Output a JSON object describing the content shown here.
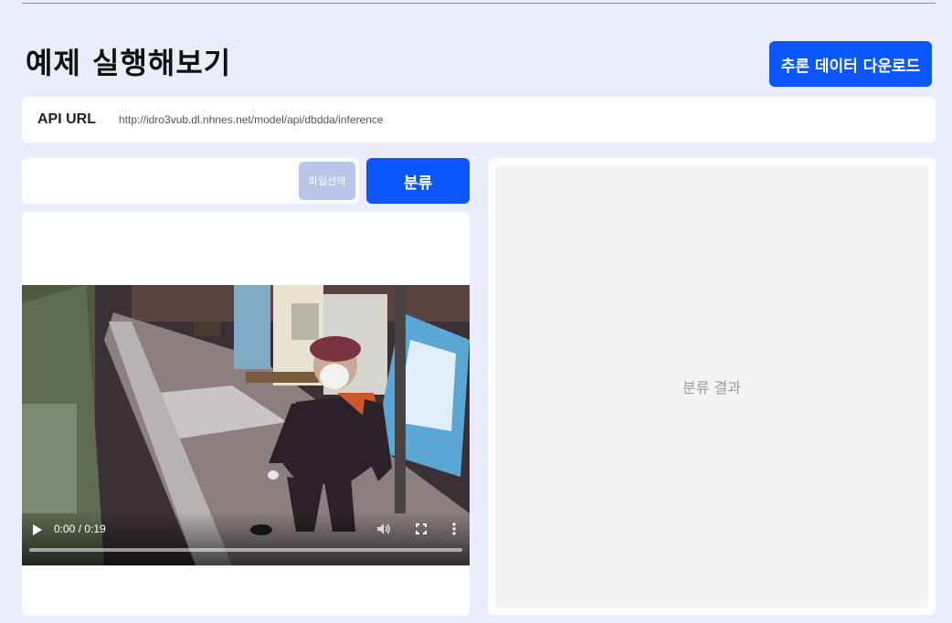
{
  "page": {
    "title": "예제 실행해보기",
    "download_button_label": "추론 데이터 다운로드"
  },
  "api": {
    "label": "API URL",
    "url": "http://idro3vub.dl.nhnes.net/model/api/dbdda/inference"
  },
  "upload": {
    "file_name": "",
    "file_select_label": "파일선택",
    "classify_label": "분류"
  },
  "video": {
    "current_time": "0:00",
    "duration": "0:19",
    "time_display": "0:00 / 0:19",
    "progress_fraction": 0.0,
    "play_icon": "play-icon",
    "volume_icon": "volume-icon",
    "fullscreen_icon": "fullscreen-icon",
    "more_icon": "more-vertical-icon"
  },
  "result": {
    "placeholder": "분류 결과"
  },
  "colors": {
    "background": "#eaeefc",
    "accent": "#0b57ff",
    "file_button": "#b9c6ea",
    "result_area": "#f4f4f5"
  }
}
